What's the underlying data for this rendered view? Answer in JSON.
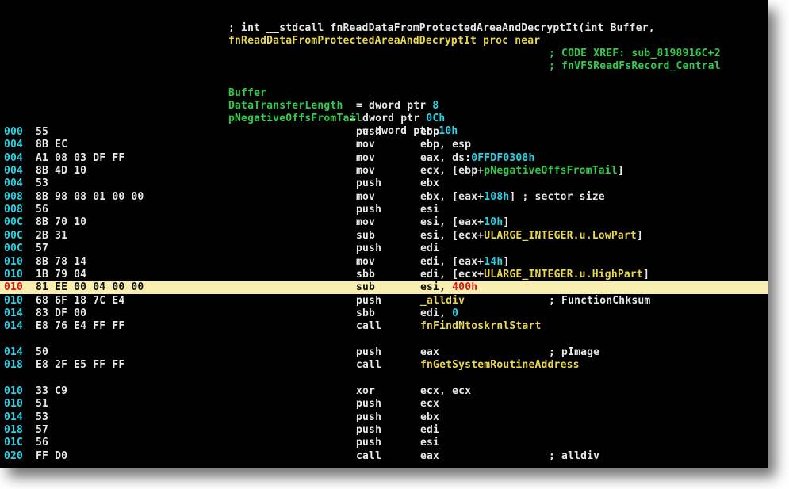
{
  "header": {
    "signature_comment": "; int __stdcall fnReadDataFromProtectedAreaAndDecryptIt(int Buffer,",
    "proc_name": "fnReadDataFromProtectedAreaAndDecryptIt",
    "proc_suffix": " proc near",
    "xrefs": [
      "; CODE XREF: sub_8198916C+2",
      "; fnVFSReadFsRecord_Central"
    ]
  },
  "variables": [
    {
      "name": "Buffer",
      "decl": "= dword ptr ",
      "offset": "8"
    },
    {
      "name": "DataTransferLength",
      "decl": "= dword ptr ",
      "offset": "0Ch"
    },
    {
      "name": "pNegativeOffsFromTail",
      "decl": "= dword ptr ",
      "offset": "10h"
    }
  ],
  "instructions": [
    {
      "addr": "000",
      "bytes": "55",
      "mn": "push",
      "ops": [
        [
          "ebp",
          "w"
        ]
      ]
    },
    {
      "addr": "004",
      "bytes": "8B EC",
      "mn": "mov",
      "ops": [
        [
          "ebp, esp",
          "w"
        ]
      ]
    },
    {
      "addr": "004",
      "bytes": "A1 08 03 DF FF",
      "mn": "mov",
      "ops": [
        [
          "eax, ds:",
          "w"
        ],
        [
          "0FFDF0308h",
          "c"
        ]
      ]
    },
    {
      "addr": "004",
      "bytes": "8B 4D 10",
      "mn": "mov",
      "ops": [
        [
          "ecx, [ebp+",
          "w"
        ],
        [
          "pNegativeOffsFromTail",
          "g"
        ],
        [
          "]",
          "w"
        ]
      ]
    },
    {
      "addr": "004",
      "bytes": "53",
      "mn": "push",
      "ops": [
        [
          "ebx",
          "w"
        ]
      ]
    },
    {
      "addr": "008",
      "bytes": "8B 98 08 01 00 00",
      "mn": "mov",
      "ops": [
        [
          "ebx, [eax+",
          "w"
        ],
        [
          "108h",
          "c"
        ],
        [
          "] ; sector size",
          "w"
        ]
      ]
    },
    {
      "addr": "008",
      "bytes": "56",
      "mn": "push",
      "ops": [
        [
          "esi",
          "w"
        ]
      ]
    },
    {
      "addr": "00C",
      "bytes": "8B 70 10",
      "mn": "mov",
      "ops": [
        [
          "esi, [eax+",
          "w"
        ],
        [
          "10h",
          "c"
        ],
        [
          "]",
          "w"
        ]
      ]
    },
    {
      "addr": "00C",
      "bytes": "2B 31",
      "mn": "sub",
      "ops": [
        [
          "esi, [ecx+",
          "w"
        ],
        [
          "ULARGE_INTEGER.u.LowPart",
          "y"
        ],
        [
          "]",
          "w"
        ]
      ]
    },
    {
      "addr": "00C",
      "bytes": "57",
      "mn": "push",
      "ops": [
        [
          "edi",
          "w"
        ]
      ]
    },
    {
      "addr": "010",
      "bytes": "8B 78 14",
      "mn": "mov",
      "ops": [
        [
          "edi, [eax+",
          "w"
        ],
        [
          "14h",
          "c"
        ],
        [
          "]",
          "w"
        ]
      ]
    },
    {
      "addr": "010",
      "bytes": "1B 79 04",
      "mn": "sbb",
      "ops": [
        [
          "edi, [ecx+",
          "w"
        ],
        [
          "ULARGE_INTEGER.u.HighPart",
          "y"
        ],
        [
          "]",
          "w"
        ]
      ]
    },
    {
      "addr": "010",
      "bytes": "81 EE 00 04 00 00",
      "mn": "sub",
      "ops": [
        [
          "esi, ",
          "w"
        ],
        [
          "400h",
          "r"
        ]
      ],
      "highlight": true
    },
    {
      "addr": "010",
      "bytes": "68 6F 18 7C E4",
      "mn": "push",
      "ops": [
        [
          "_alldiv",
          "y"
        ]
      ],
      "comment": "; FunctionChksum"
    },
    {
      "addr": "014",
      "bytes": "83 DF 00",
      "mn": "sbb",
      "ops": [
        [
          "edi, ",
          "w"
        ],
        [
          "0",
          "c"
        ]
      ]
    },
    {
      "addr": "014",
      "bytes": "E8 76 E4 FF FF",
      "mn": "call",
      "ops": [
        [
          "fnFindNtoskrnlStart",
          "y"
        ]
      ]
    },
    {
      "blank": true
    },
    {
      "addr": "014",
      "bytes": "50",
      "mn": "push",
      "ops": [
        [
          "eax",
          "w"
        ]
      ],
      "comment": "; pImage"
    },
    {
      "addr": "018",
      "bytes": "E8 2F E5 FF FF",
      "mn": "call",
      "ops": [
        [
          "fnGetSystemRoutineAddress",
          "y"
        ]
      ]
    },
    {
      "blank": true
    },
    {
      "addr": "010",
      "bytes": "33 C9",
      "mn": "xor",
      "ops": [
        [
          "ecx, ecx",
          "w"
        ]
      ]
    },
    {
      "addr": "010",
      "bytes": "51",
      "mn": "push",
      "ops": [
        [
          "ecx",
          "w"
        ]
      ]
    },
    {
      "addr": "014",
      "bytes": "53",
      "mn": "push",
      "ops": [
        [
          "ebx",
          "w"
        ]
      ]
    },
    {
      "addr": "018",
      "bytes": "57",
      "mn": "push",
      "ops": [
        [
          "edi",
          "w"
        ]
      ]
    },
    {
      "addr": "01C",
      "bytes": "56",
      "mn": "push",
      "ops": [
        [
          "esi",
          "w"
        ]
      ]
    },
    {
      "addr": "020",
      "bytes": "FF D0",
      "mn": "call",
      "ops": [
        [
          "eax",
          "w"
        ]
      ],
      "comment": "; alldiv"
    }
  ],
  "colors": {
    "background": "#000000",
    "highlight_bar": "#f7eeb0",
    "address": "#2ad2e6",
    "names": "#e8d84a",
    "comments_green": "#2ecc4a",
    "immediate_red": "#d81818"
  }
}
